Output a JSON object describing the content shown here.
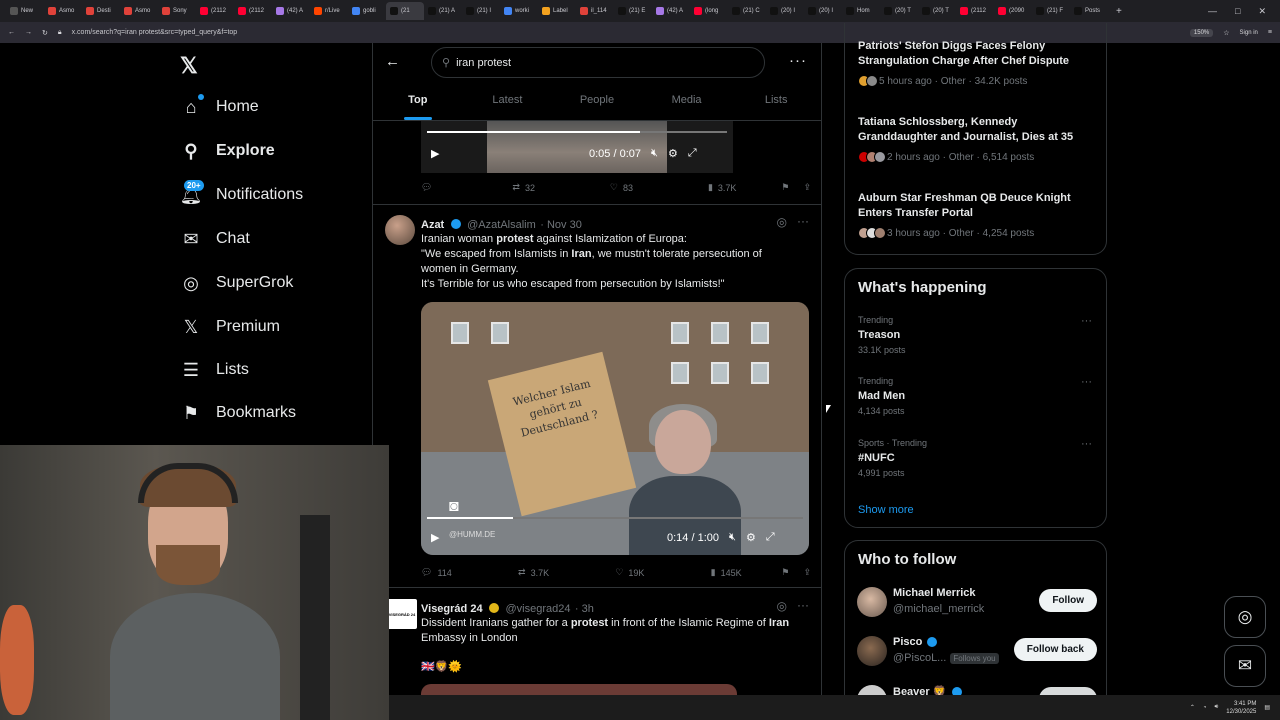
{
  "browser": {
    "tabs": [
      {
        "label": "New",
        "color": "#555"
      },
      {
        "label": "Asmo",
        "color": "#e0423a"
      },
      {
        "label": "Desti",
        "color": "#e0423a"
      },
      {
        "label": "Asmo",
        "color": "#e0423a"
      },
      {
        "label": "Sony",
        "color": "#e0423a"
      },
      {
        "label": "(2112",
        "color": "#ff0033"
      },
      {
        "label": "(2112",
        "color": "#ff0033"
      },
      {
        "label": "(42) A",
        "color": "#a678e6"
      },
      {
        "label": "r/Live",
        "color": "#ff4500"
      },
      {
        "label": "gobli",
        "color": "#4285f4"
      },
      {
        "label": "(21",
        "color": "#111",
        "active": true
      },
      {
        "label": "(21) A",
        "color": "#111"
      },
      {
        "label": "(21) I",
        "color": "#111"
      },
      {
        "label": "worki",
        "color": "#4285f4"
      },
      {
        "label": "Label",
        "color": "#f4a21f"
      },
      {
        "label": "il_114",
        "color": "#e0423a"
      },
      {
        "label": "(21) E",
        "color": "#111"
      },
      {
        "label": "(42) A",
        "color": "#a678e6"
      },
      {
        "label": "(long",
        "color": "#ff0033"
      },
      {
        "label": "(21) C",
        "color": "#111"
      },
      {
        "label": "(20) I",
        "color": "#111"
      },
      {
        "label": "(20) I",
        "color": "#111"
      },
      {
        "label": "Hom",
        "color": "#111"
      },
      {
        "label": "(20) T",
        "color": "#111"
      },
      {
        "label": "(20) T",
        "color": "#111"
      },
      {
        "label": "(2112",
        "color": "#ff0033"
      },
      {
        "label": "(2090",
        "color": "#ff0033"
      },
      {
        "label": "(21) F",
        "color": "#111"
      },
      {
        "label": "Posts",
        "color": "#111"
      }
    ],
    "url": "x.com/search?q=iran protest&src=typed_query&f=top",
    "zoom": "150%",
    "signin": "Sign in"
  },
  "nav": {
    "logo": "𝕏",
    "items": [
      {
        "label": "Home",
        "icon": "⌂"
      },
      {
        "label": "Explore",
        "icon": "⚲"
      },
      {
        "label": "Notifications",
        "icon": "🔔︎",
        "badge": "20+"
      },
      {
        "label": "Chat",
        "icon": "✉"
      },
      {
        "label": "SuperGrok",
        "icon": "◎"
      },
      {
        "label": "Premium",
        "icon": "𝕏"
      },
      {
        "label": "Lists",
        "icon": "☰"
      },
      {
        "label": "Bookmarks",
        "icon": "⚑"
      }
    ]
  },
  "search": {
    "query": "iran protest",
    "tabs": [
      "Top",
      "Latest",
      "People",
      "Media",
      "Lists"
    ]
  },
  "video1": {
    "time": "0:05 / 0:07",
    "progress": 0.71,
    "stats": {
      "reply": "",
      "repost": "32",
      "like": "83",
      "views": "3.7K"
    }
  },
  "post1": {
    "name": "Azat",
    "handle": "@AzatAlsalim",
    "date": "· Nov 30",
    "line1_pre": "Iranian woman ",
    "line1_bold": "protest",
    "line1_post": " against Islamization of Europa:",
    "line2_pre": "\"We escaped from Islamists in ",
    "line2_bold": "Iran",
    "line2_post": ", we mustn't tolerate persecution of",
    "line3": "women in Germany.",
    "line4": "It's Terrible for us who escaped from persecution by Islamists!\"",
    "sign_text": "Welcher Islam gehört zu Deutschland ?",
    "watermark": "@HUMM.DE",
    "time": "0:14 / 1:00",
    "progress": 0.23,
    "stats": {
      "reply": "114",
      "repost": "3.7K",
      "like": "19K",
      "views": "145K"
    }
  },
  "post2": {
    "name": "Visegrád 24",
    "handle": "@visegrad24",
    "date": "· 3h",
    "avatar_text": "VISEGRÁD 24",
    "line1_pre": "Dissident Iranians gather for a ",
    "line1_bold": "protest",
    "line1_mid": " in front of the Islamic Regime of ",
    "line1_bold2": "Iran",
    "line2": "Embassy in London",
    "emojis": "🇬🇧🦁🌞"
  },
  "news": [
    {
      "title": "Patriots' Stefon Diggs Faces Felony Strangulation Charge After Chef Dispute",
      "meta": "5 hours ago · Other · 34.2K posts"
    },
    {
      "title": "Tatiana Schlossberg, Kennedy Granddaughter and Journalist, Dies at 35",
      "meta": "2 hours ago · Other · 6,514 posts"
    },
    {
      "title": "Auburn Star Freshman QB Deuce Knight Enters Transfer Portal",
      "meta": "3 hours ago · Other · 4,254 posts"
    }
  ],
  "happening": {
    "title": "What's happening",
    "trends": [
      {
        "context": "Trending",
        "name": "Treason",
        "posts": "33.1K posts"
      },
      {
        "context": "Trending",
        "name": "Mad Men",
        "posts": "4,134 posts"
      },
      {
        "context": "Sports · Trending",
        "name": "#NUFC",
        "posts": "4,991 posts"
      }
    ],
    "show_more": "Show more"
  },
  "who_to_follow": {
    "title": "Who to follow",
    "users": [
      {
        "name": "Michael Merrick",
        "handle": "@michael_merrick",
        "button": "Follow",
        "follows_you": ""
      },
      {
        "name": "Pisco",
        "handle": "@PiscoL...",
        "button": "Follow back",
        "follows_you": "Follows you"
      },
      {
        "name": "Beaver 🦁",
        "handle": "",
        "button": "",
        "follows_you": ""
      }
    ]
  },
  "taskbar": {
    "time": "3:41 PM",
    "date": "12/30/2025"
  }
}
